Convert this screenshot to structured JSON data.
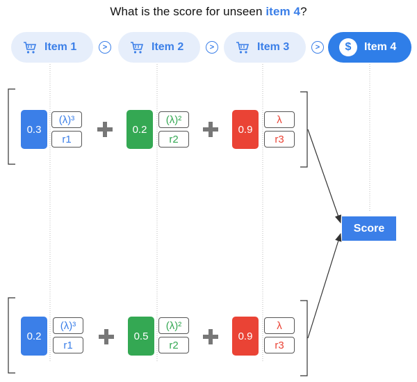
{
  "question": {
    "prefix": "What is the score for unseen ",
    "highlight": "item 4",
    "suffix": "?"
  },
  "items": [
    {
      "label": "Item 1",
      "icon": "cart-icon"
    },
    {
      "label": "Item 2",
      "icon": "cart-icon"
    },
    {
      "label": "Item 3",
      "icon": "cart-icon"
    },
    {
      "label": "Item 4",
      "icon": "dollar-icon",
      "symbol": "$"
    }
  ],
  "chevron_symbol": ">",
  "rows": [
    {
      "terms": [
        {
          "weight": "0.3",
          "lambda": "(λ)³",
          "rating": "r1",
          "color": "#3b7fe8"
        },
        {
          "weight": "0.2",
          "lambda": "(λ)²",
          "rating": "r2",
          "color": "#34a853"
        },
        {
          "weight": "0.9",
          "lambda": "λ",
          "rating": "r3",
          "color": "#ea4335"
        }
      ]
    },
    {
      "terms": [
        {
          "weight": "0.2",
          "lambda": "(λ)³",
          "rating": "r1",
          "color": "#3b7fe8"
        },
        {
          "weight": "0.5",
          "lambda": "(λ)²",
          "rating": "r2",
          "color": "#34a853"
        },
        {
          "weight": "0.9",
          "lambda": "λ",
          "rating": "r3",
          "color": "#ea4335"
        }
      ]
    }
  ],
  "score_label": "Score"
}
